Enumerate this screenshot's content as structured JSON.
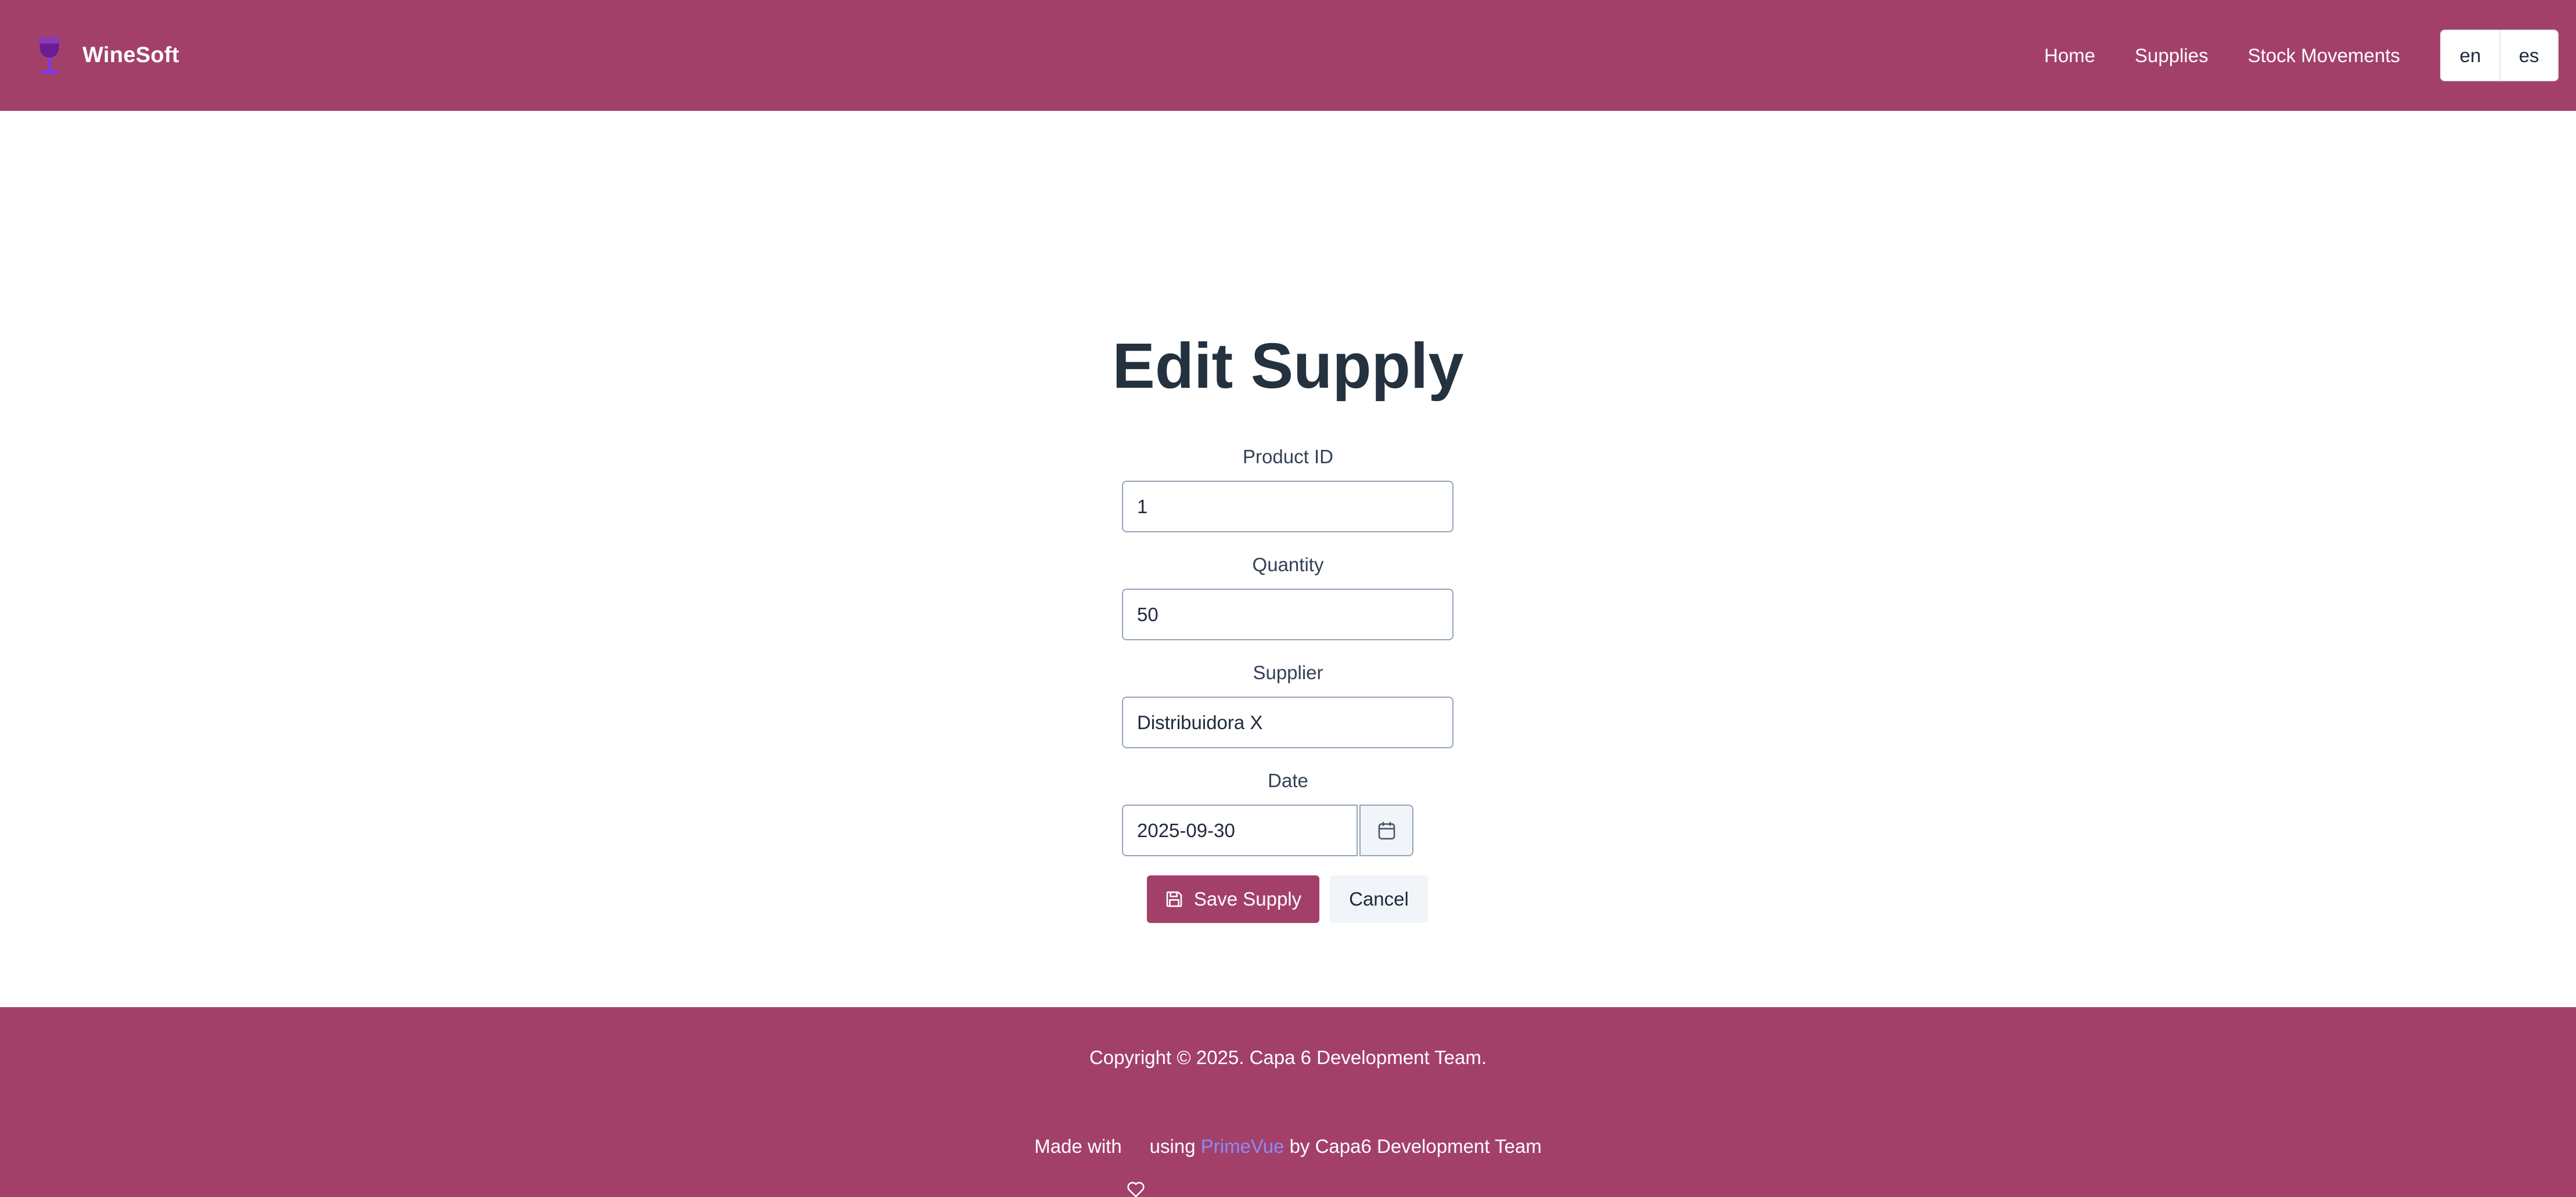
{
  "header": {
    "logo_icon": "wine-glass-icon",
    "brand": "WineSoft",
    "nav": {
      "home": "Home",
      "supplies": "Supplies",
      "stock_movements": "Stock Movements"
    },
    "languages": [
      "en",
      "es"
    ]
  },
  "form": {
    "title": "Edit Supply",
    "product_id": {
      "label": "Product ID",
      "value": "1"
    },
    "quantity": {
      "label": "Quantity",
      "value": "50"
    },
    "supplier": {
      "label": "Supplier",
      "value": "Distribuidora X"
    },
    "date": {
      "label": "Date",
      "value": "2025-09-30",
      "icon": "calendar-icon"
    },
    "save_label": "Save Supply",
    "save_icon": "save-icon",
    "cancel_label": "Cancel"
  },
  "footer": {
    "copyright": "Copyright © 2025. Capa 6 Development Team.",
    "made_with": "Made with",
    "heart_icon": "heart-icon",
    "using": "using",
    "primevue_link": "PrimeVue",
    "by": "by Capa6 Development Team"
  },
  "colors": {
    "brand": "#a3406a",
    "title": "#24313f",
    "link": "#8b8bf5",
    "logo": "#7c3aed"
  }
}
